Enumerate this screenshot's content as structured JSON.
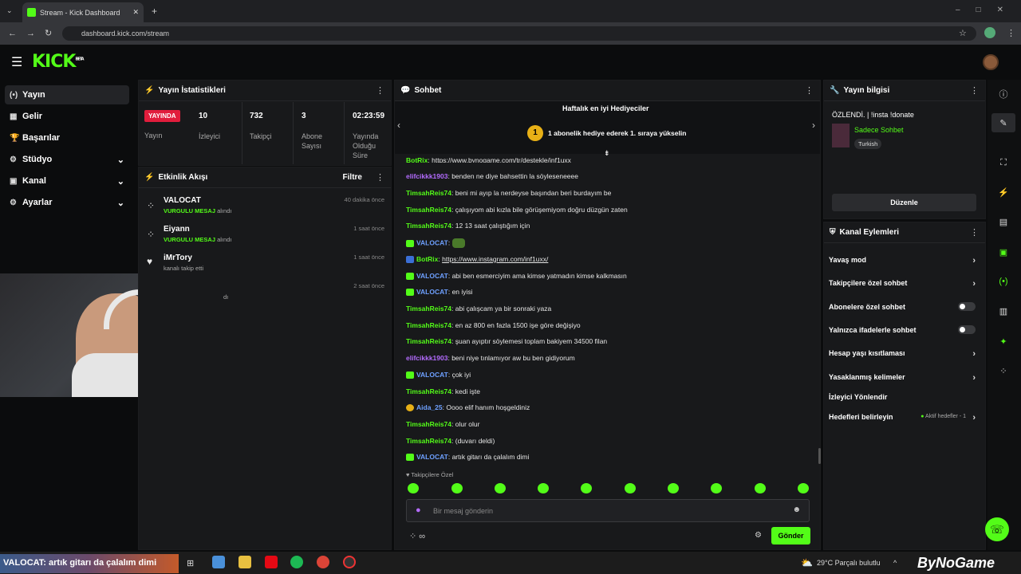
{
  "browser": {
    "tab_title": "Stream - Kick Dashboard",
    "url": "dashboard.kick.com/stream"
  },
  "brand": {
    "logo": "KICK",
    "beta": "BETA",
    "accent": "#53fc18"
  },
  "nav": [
    {
      "icon": "broadcast-icon",
      "glyph": "(•)",
      "label": "Yayın"
    },
    {
      "icon": "revenue-icon",
      "glyph": "▦",
      "label": "Gelir"
    },
    {
      "icon": "trophy-icon",
      "glyph": "🏆",
      "label": "Başarılar"
    },
    {
      "icon": "studio-icon",
      "glyph": "⚙",
      "label": "Stüdyo"
    },
    {
      "icon": "channel-icon",
      "glyph": "▣",
      "label": "Kanal"
    },
    {
      "icon": "settings-icon",
      "glyph": "⚙",
      "label": "Ayarlar"
    }
  ],
  "stats": {
    "title": "Yayın İstatistikleri",
    "live_badge": "YAYINDA",
    "live_label": "Yayın",
    "items": [
      {
        "value": "10",
        "label": "İzleyici"
      },
      {
        "value": "732",
        "label": "Takipçi"
      },
      {
        "value": "3",
        "label": "Abone Sayısı"
      },
      {
        "value": "02:23:59",
        "label": "Yayında Olduğu Süre"
      }
    ]
  },
  "activity": {
    "title": "Etkinlik Akışı",
    "filter": "Filtre",
    "items": [
      {
        "user": "VALOCAT",
        "highlight": "VURGULU MESAJ",
        "rest": " alındı",
        "time": "40 dakika önce"
      },
      {
        "user": "Eiyann",
        "highlight": "VURGULU MESAJ",
        "rest": " alındı",
        "time": "1 saat önce"
      },
      {
        "user": "iMrTory",
        "highlight": "",
        "rest": "kanalı takip etti",
        "time": "1 saat önce"
      },
      {
        "user": "",
        "highlight": "",
        "rest": "dı",
        "time": "2 saat önce"
      }
    ]
  },
  "chat": {
    "title": "Sohbet",
    "gifters_title": "Haftalık en iyi Hediyeciler",
    "gift_rank": "1",
    "gifters_text": "1 abonelik hediye ederek 1. sıraya yükselin",
    "top_partial": {
      "user": "BotRix",
      "text": "https://www.bynogame.com/tr/destekle/inf1uxx"
    },
    "messages": [
      {
        "user": "elifcikkk1903",
        "color": "p",
        "badge": false,
        "text": "benden ne diye bahsettin la söyleseneeee"
      },
      {
        "user": "TimsahReis74",
        "color": "g",
        "badge": false,
        "text": "beni mi ayıp la nerdeyse başından beri burdayım be"
      },
      {
        "user": "TimsahReis74",
        "color": "g",
        "badge": false,
        "text": "çalışıyom abi kızla bile görüşemiyom doğru düzgün zaten"
      },
      {
        "user": "TimsahReis74",
        "color": "g",
        "badge": false,
        "text": "12 13 saat çalıştığım için"
      },
      {
        "user": "VALOCAT",
        "color": "b",
        "badge": true,
        "text": ""
      },
      {
        "user": "BotRix",
        "color": "g",
        "badge": true,
        "text": "https://www.instagram.com/inf1uxx/"
      },
      {
        "user": "VALOCAT",
        "color": "b",
        "badge": true,
        "text": "abi ben esmerciyim ama kimse yatmadın kimse kalkmasın"
      },
      {
        "user": "VALOCAT",
        "color": "b",
        "badge": true,
        "text": "en iyisi"
      },
      {
        "user": "TimsahReis74",
        "color": "g",
        "badge": false,
        "text": "abi çalışcam ya bir sonraki yaza"
      },
      {
        "user": "TimsahReis74",
        "color": "g",
        "badge": false,
        "text": "en az 800 en fazla 1500 işe göre değişiyo"
      },
      {
        "user": "TimsahReis74",
        "color": "g",
        "badge": false,
        "text": "şuan ayıptır söylemesi toplam bakiyem 34500 filan"
      },
      {
        "user": "elifcikkk1903",
        "color": "p",
        "badge": false,
        "text": "beni niye tınlamıyor aw bu ben gidiyorum"
      },
      {
        "user": "VALOCAT",
        "color": "b",
        "badge": true,
        "text": "çok iyi"
      },
      {
        "user": "TimsahReis74",
        "color": "g",
        "badge": false,
        "text": "kedi işte"
      },
      {
        "user": "Aida_25",
        "color": "b",
        "badge": true,
        "text": "Oooo elif hanım hoşgeldiniz"
      },
      {
        "user": "TimsahReis74",
        "color": "g",
        "badge": false,
        "text": "olur olur"
      },
      {
        "user": "TimsahReis74",
        "color": "g",
        "badge": false,
        "text": "(duvarı deldi)"
      },
      {
        "user": "VALOCAT",
        "color": "b",
        "badge": true,
        "text": "artık gitarı da çalalım dimi"
      }
    ],
    "followers_only": "Takipçilere Özel",
    "placeholder": "Bir mesaj gönderin",
    "send": "Gönder"
  },
  "stream_info": {
    "title": "Yayın bilgisi",
    "stream_title": "ÖZLENDİ. | !insta !donate",
    "category": "Sadece Sohbet",
    "language": "Turkish",
    "edit": "Düzenle"
  },
  "channel_actions": {
    "title": "Kanal Eylemleri",
    "items": [
      {
        "label": "Yavaş mod",
        "kind": "arrow"
      },
      {
        "label": "Takipçilere özel sohbet",
        "kind": "arrow"
      },
      {
        "label": "Abonelere özel sohbet",
        "kind": "toggle"
      },
      {
        "label": "Yalnızca ifadelerle sohbet",
        "kind": "toggle"
      },
      {
        "label": "Hesap yaşı kısıtlaması",
        "kind": "arrow"
      },
      {
        "label": "Yasaklanmış kelimeler",
        "kind": "arrow"
      },
      {
        "label": "İzleyici Yönlendir",
        "kind": "none"
      },
      {
        "label": "Hedefleri belirleyin",
        "kind": "arrow"
      }
    ],
    "goals_status": "Aktif hedefler - 1"
  },
  "taskbar": {
    "overlay_text": "VALOCAT: artık gitarı da çalalım dimi",
    "weather": "29°C  Parçalı bulutlu",
    "watermark": "ByNoGame"
  }
}
